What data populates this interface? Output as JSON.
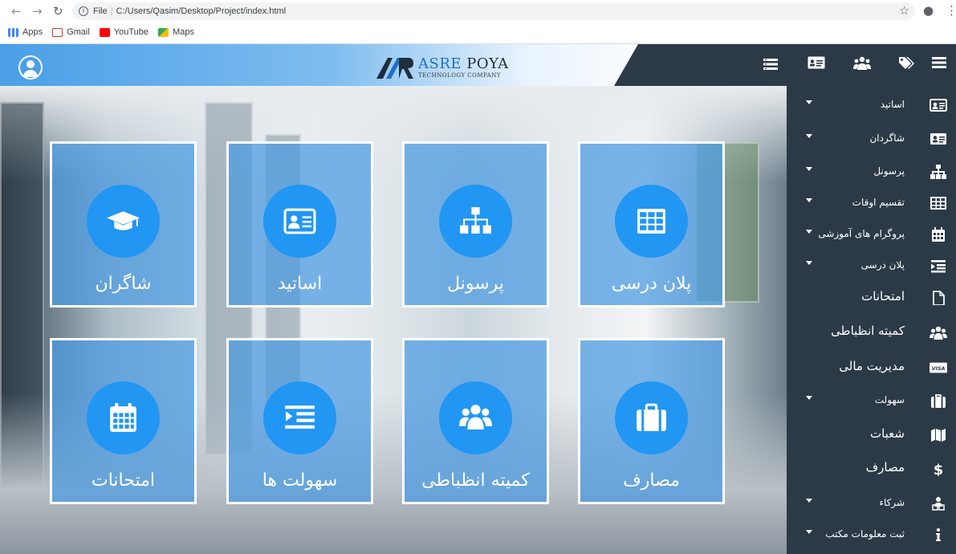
{
  "browser": {
    "url_prefix": "File",
    "url": "C:/Users/Qasim/Desktop/Project/index.html",
    "bookmarks": [
      "Apps",
      "Gmail",
      "YouTube",
      "Maps"
    ]
  },
  "header": {
    "logo_main_1": "ASRE ",
    "logo_main_2": "POYA",
    "logo_sub": "TECHNOLOGY COMPANY",
    "icons": [
      "menu-icon",
      "tags-icon",
      "users-icon",
      "id-card-icon",
      "list-icon"
    ]
  },
  "tiles": [
    {
      "label": "شاگران",
      "icon": "graduation-cap-icon"
    },
    {
      "label": "اساتید",
      "icon": "id-card-icon"
    },
    {
      "label": "پرسونل",
      "icon": "sitemap-icon"
    },
    {
      "label": "پلان درسی",
      "icon": "table-icon"
    },
    {
      "label": "امتحانات",
      "icon": "calendar-icon"
    },
    {
      "label": "سهولت ها",
      "icon": "indent-icon"
    },
    {
      "label": "کمیته انظباطی",
      "icon": "users-icon"
    },
    {
      "label": "مصارف",
      "icon": "briefcase-icon"
    }
  ],
  "sidebar": {
    "items": [
      {
        "label": "اساتید",
        "icon": "id-card-icon",
        "dropdown": true
      },
      {
        "label": "شاگردان",
        "icon": "id-badge-icon",
        "dropdown": true
      },
      {
        "label": "پرسونل",
        "icon": "sitemap-icon",
        "dropdown": true
      },
      {
        "label": "تقسیم اوقات",
        "icon": "table-icon",
        "dropdown": true
      },
      {
        "label": "پروگرام های آموزشی",
        "icon": "calendar-icon",
        "dropdown": true
      },
      {
        "label": "پلان درسی",
        "icon": "indent-icon",
        "dropdown": true
      },
      {
        "label": "امتحانات",
        "icon": "file-icon",
        "dropdown": false
      },
      {
        "label": "کمیته انظباطی",
        "icon": "users-icon",
        "dropdown": false
      },
      {
        "label": "مدیریت مالی",
        "icon": "visa-icon",
        "dropdown": false
      },
      {
        "label": "سهولت",
        "icon": "suitcase-icon",
        "dropdown": true
      },
      {
        "label": "شعبات",
        "icon": "map-icon",
        "dropdown": false
      },
      {
        "label": "مصارف",
        "icon": "dollar-icon",
        "dropdown": false
      },
      {
        "label": "شرکاء",
        "icon": "partners-icon",
        "dropdown": true
      },
      {
        "label": "ثبت معلومات مکتب",
        "icon": "info-icon",
        "dropdown": true
      }
    ]
  },
  "colors": {
    "sidebar_bg": "#2c3a47",
    "tile_circle": "#2196f3",
    "tile_bg": "#4a9ae2"
  }
}
